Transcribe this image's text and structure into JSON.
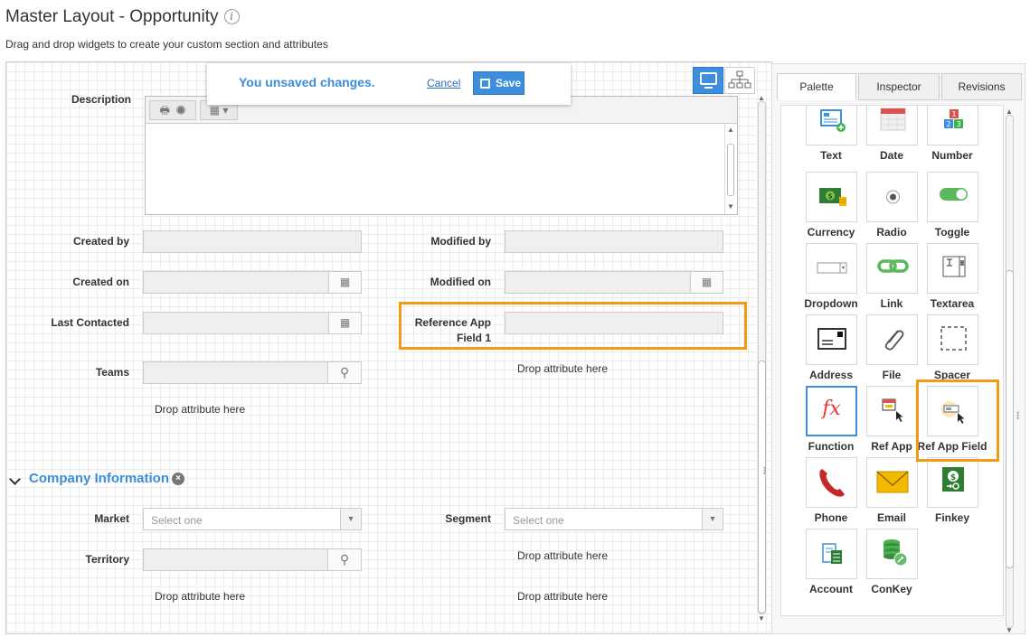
{
  "page": {
    "title": "Master Layout - Opportunity",
    "subtitle": "Drag and drop widgets to create your custom section and attributes"
  },
  "notice": {
    "message": "You unsaved changes.",
    "cancel": "Cancel",
    "save": "Save"
  },
  "form": {
    "description_label": "Description",
    "created_by_label": "Created by",
    "modified_by_label": "Modified by",
    "created_on_label": "Created on",
    "modified_on_label": "Modified on",
    "last_contacted_label": "Last Contacted",
    "ref_app_label_line1": "Reference App",
    "ref_app_label_line2": "Field 1",
    "teams_label": "Teams",
    "drop_text": "Drop attribute here"
  },
  "section": {
    "title": "Company Information",
    "market_label": "Market",
    "segment_label": "Segment",
    "territory_label": "Territory",
    "select_placeholder": "Select one"
  },
  "panel": {
    "tabs": [
      "Palette",
      "Inspector",
      "Revisions"
    ],
    "active_tab": "Palette",
    "widgets": [
      "Text",
      "Date",
      "Number",
      "Currency",
      "Radio",
      "Toggle",
      "Dropdown",
      "Link",
      "Textarea",
      "Address",
      "File",
      "Spacer",
      "Function",
      "Ref App",
      "Ref App Field",
      "Phone",
      "Email",
      "Finkey",
      "Account",
      "ConKey"
    ],
    "highlighted_widget": "Ref App Field"
  },
  "colors": {
    "accent": "#3d8fde",
    "highlight": "#f39b12",
    "link": "#3b8ed6"
  }
}
